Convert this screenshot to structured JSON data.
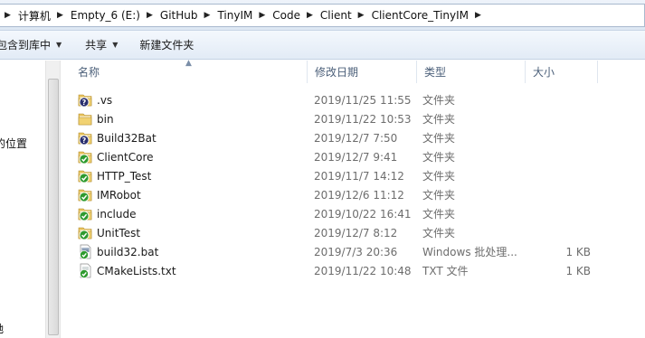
{
  "address": {
    "crumbs": [
      "计算机",
      "Empty_6 (E:)",
      "GitHub",
      "TinyIM",
      "Code",
      "Client",
      "ClientCore_TinyIM"
    ]
  },
  "toolbar": {
    "include_library": "包含到库中",
    "share": "共享",
    "new_folder": "新建文件夹"
  },
  "nav": {
    "visible_fragment": "的位置",
    "bottom_fragment": "驰"
  },
  "columns": {
    "name": "名称",
    "date": "修改日期",
    "type": "类型",
    "size": "大小"
  },
  "files": [
    {
      "name": ".vs",
      "date": "2019/11/25 11:55",
      "type": "文件夹",
      "size": "",
      "icon": "folder-question-icon"
    },
    {
      "name": "bin",
      "date": "2019/11/22 10:53",
      "type": "文件夹",
      "size": "",
      "icon": "folder-plain-icon"
    },
    {
      "name": "Build32Bat",
      "date": "2019/12/7 7:50",
      "type": "文件夹",
      "size": "",
      "icon": "folder-question-icon"
    },
    {
      "name": "ClientCore",
      "date": "2019/12/7 9:41",
      "type": "文件夹",
      "size": "",
      "icon": "folder-check-icon"
    },
    {
      "name": "HTTP_Test",
      "date": "2019/11/7 14:12",
      "type": "文件夹",
      "size": "",
      "icon": "folder-check-icon"
    },
    {
      "name": "IMRobot",
      "date": "2019/12/6 11:12",
      "type": "文件夹",
      "size": "",
      "icon": "folder-check-icon"
    },
    {
      "name": "include",
      "date": "2019/10/22 16:41",
      "type": "文件夹",
      "size": "",
      "icon": "folder-check-icon"
    },
    {
      "name": "UnitTest",
      "date": "2019/12/7 8:12",
      "type": "文件夹",
      "size": "",
      "icon": "folder-check-icon"
    },
    {
      "name": "build32.bat",
      "date": "2019/7/3 20:36",
      "type": "Windows 批处理...",
      "size": "1 KB",
      "icon": "bat-file-check-icon"
    },
    {
      "name": "CMakeLists.txt",
      "date": "2019/11/22 10:48",
      "type": "TXT 文件",
      "size": "1 KB",
      "icon": "text-file-check-icon"
    }
  ],
  "colors": {
    "folder": "#e8c25a",
    "check_green": "#2e9a2e",
    "question_navy": "#2a2f6e",
    "header_text": "#4c607a"
  }
}
